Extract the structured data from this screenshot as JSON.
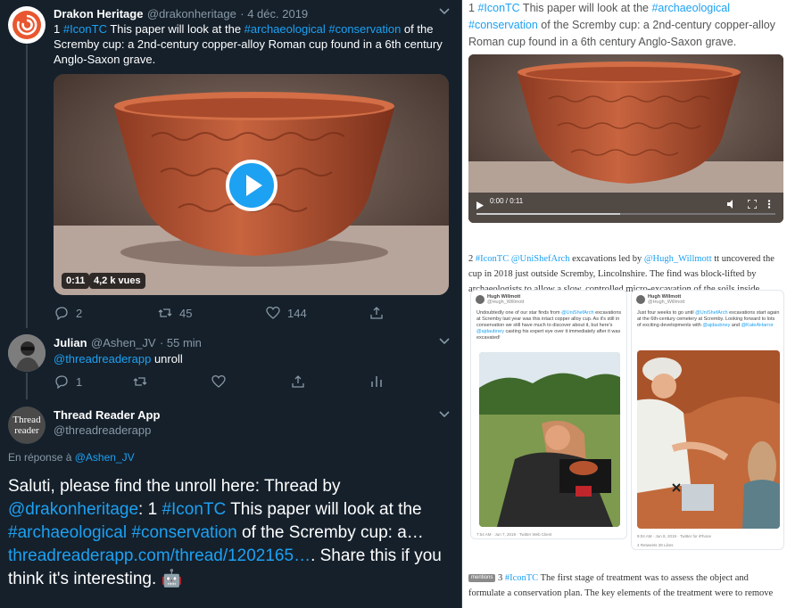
{
  "thread": {
    "tweet1": {
      "author_name": "Drakon Heritage",
      "handle": "@drakonheritage",
      "date": "· 4 déc. 2019",
      "text_num": "1 ",
      "tag1": "#IconTC",
      "text_a": " This paper will look at the ",
      "tag2": "#archaeological",
      "tag3": "#conservation",
      "text_b": " of the Scremby cup: a 2nd-century copper-alloy Roman cup found in a 6th century Anglo-Saxon grave.",
      "video_time": "0:11",
      "video_views": "4,2 k vues",
      "replies": "2",
      "retweets": "45",
      "likes": "144"
    },
    "tweet2": {
      "author_name": "Julian",
      "handle": "@Ashen_JV",
      "date": "· 55 min",
      "mention": "@threadreaderapp",
      "text": " unroll",
      "replies": "1"
    },
    "tweet3": {
      "author_name": "Thread Reader App",
      "handle": "@threadreaderapp",
      "avatar_line1": "Thread",
      "avatar_line2": "reader",
      "reply_prefix": "En réponse à ",
      "reply_to": "@Ashen_JV",
      "body_a": "Saluti, please find the unroll here: Thread by ",
      "mention": "@drakonheritage",
      "body_b": ": 1 ",
      "tag1": "#IconTC",
      "body_c": " This paper will look at the ",
      "tag2": "#archaeological",
      "tag3": "#conservation",
      "body_d": " of the Scremby cup: a…",
      "link": "threadreaderapp.com/thread/1202165…",
      "body_e": ". Share this if you think it's interesting. ",
      "emoji": "🤖"
    }
  },
  "reader": {
    "p1_num": "1 ",
    "p1_tag1": "#IconTC",
    "p1_a": " This paper will look at the ",
    "p1_tag2": "#archaeological",
    "p1_tag3": "#conservation",
    "p1_b": " of the Scremby cup: a 2nd-century copper-alloy Roman cup found in a 6th century Anglo-Saxon grave.",
    "video_time": "0:00 / 0:11",
    "p2_num": "2 ",
    "p2_tag": "#IconTC",
    "p2_m1": "@UniShefArch",
    "p2_a": " excavations led by ",
    "p2_m2": "@Hugh_Willmott",
    "p2_b": " tt uncovered the cup in 2018 just outside Scremby, Lincolnshire. The find was block-lifted by archaeologists to allow a slow, controlled micro-excavation of the soils inside.",
    "embed1": {
      "name": "Hugh Willmott",
      "handle": "@Hugh_Willmott",
      "text_a": "Undoubtedly one of our star finds from ",
      "m1": "@UniShefArch",
      "text_b": " excavations at Scremby last year was this intact copper alloy cup. As it's still in conservation we still have much to discover about it, but here's ",
      "m2": "@ajdaubney",
      "text_c": " casting his expert eye over it immediately after it was excavated!",
      "footer": "7:54 AM · Jun 7, 2019 · Twitter Web Client"
    },
    "embed2": {
      "name": "Hugh Willmott",
      "handle": "@Hugh_Willmott",
      "text_a": "Just four weeks to go until ",
      "m1": "@UniShefArch",
      "text_b": " excavations start again at the 6th-century cemetery at Scremby. Looking forward to lots of exciting developments with ",
      "m2": "@ajdaubney",
      "text_c": " and ",
      "m3": "@KateAHarror",
      "footer": "9:04 AM · Jun 8, 2019 · Twitter for iPhone",
      "stats": "4 Retweets   39 Likes"
    },
    "p3_badge": "mentions",
    "p3_num": "3 ",
    "p3_tag": "#IconTC",
    "p3_text": " The first stage of treatment was to assess the object and formulate a conservation plan. The key elements of the treatment were to remove"
  },
  "colors": {
    "bg_dark": "#15202b",
    "accent": "#1da1f2",
    "muted": "#8899a6"
  },
  "icons": [
    "reply-icon",
    "retweet-icon",
    "like-icon",
    "share-icon",
    "analytics-icon",
    "play-icon",
    "chevron-down-icon",
    "volume-icon",
    "fullscreen-icon",
    "more-icon"
  ]
}
